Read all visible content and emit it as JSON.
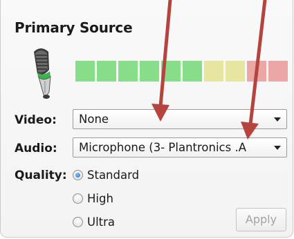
{
  "panel": {
    "title": "Primary Source",
    "icons": {
      "microphone": "microphone-icon"
    },
    "meter": {
      "segments": 10,
      "level": 0.6,
      "colors": [
        "#88dd88",
        "#88dd88",
        "#88dd88",
        "#88dd88",
        "#88dd88",
        "#88dd88",
        "#e6e6a0",
        "#e6e6a0",
        "#eca6a6",
        "#eca6a6"
      ]
    }
  },
  "video": {
    "label": "Video:",
    "value": "None"
  },
  "audio": {
    "label": "Audio:",
    "value": "Microphone (3- Plantronics .A"
  },
  "quality": {
    "label": "Quality:",
    "options": [
      {
        "label": "Standard",
        "selected": true
      },
      {
        "label": "High",
        "selected": false
      },
      {
        "label": "Ultra",
        "selected": false
      }
    ]
  },
  "apply_label": "Apply",
  "colors": {
    "arrow": "#c0504d",
    "radio_selected": "#1f6fd1",
    "disabled_text": "#a3a3a3"
  }
}
